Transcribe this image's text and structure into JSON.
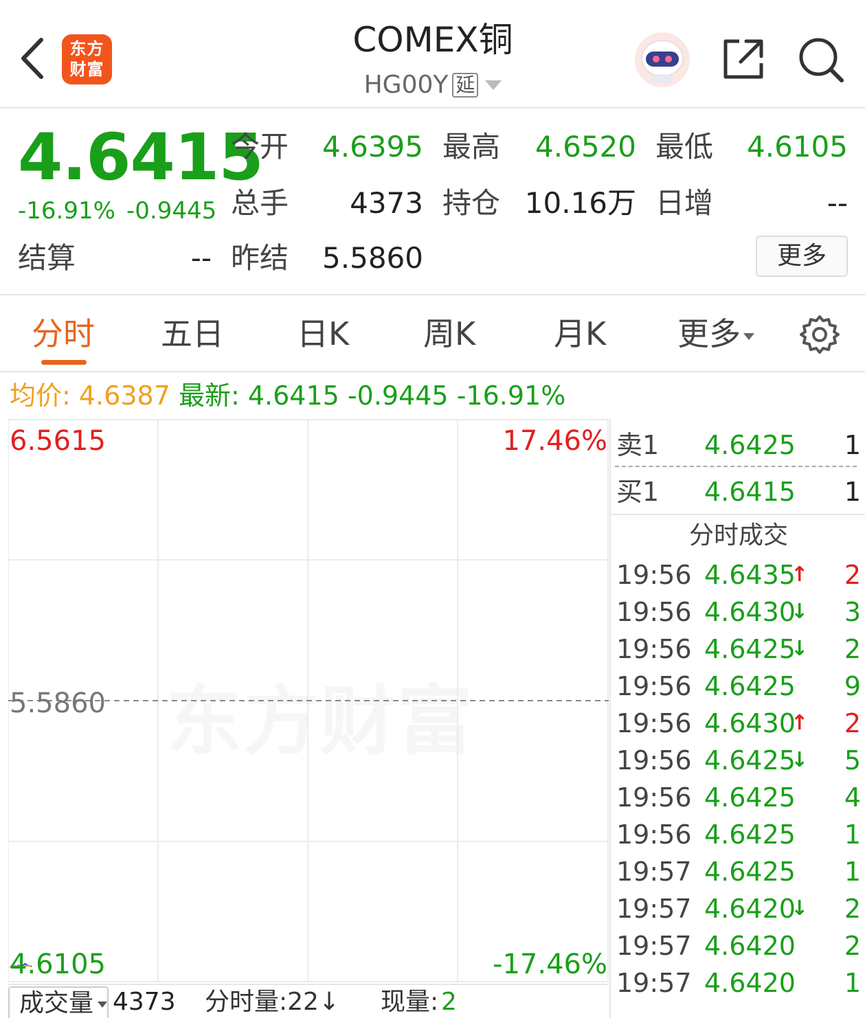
{
  "header": {
    "logo_text_line1": "东方",
    "logo_text_line2": "财富",
    "title": "COMEX铜",
    "code": "HG00Y",
    "delay_badge": "延"
  },
  "quote": {
    "price": "4.6415",
    "change_pct": "-16.91%",
    "change_amt": "-0.9445",
    "fields": {
      "open_label": "今开",
      "open_value": "4.6395",
      "high_label": "最高",
      "high_value": "4.6520",
      "low_label": "最低",
      "low_value": "4.6105",
      "volume_label": "总手",
      "volume_value": "4373",
      "oi_label": "持仓",
      "oi_value": "10.16万",
      "daily_inc_label": "日增",
      "daily_inc_value": "--",
      "settle_label": "结算",
      "settle_value": "--",
      "prev_settle_label": "昨结",
      "prev_settle_value": "5.5860"
    },
    "more_button": "更多"
  },
  "tabs": {
    "items": [
      "分时",
      "五日",
      "日K",
      "周K",
      "月K",
      "更多"
    ],
    "active_index": 0
  },
  "infoline": {
    "avg_label": "均价:",
    "avg_value": "4.6387",
    "latest_label": "最新:",
    "latest_value": "4.6415",
    "latest_chg": "-0.9445",
    "latest_pct": "-16.91%"
  },
  "chart": {
    "top_price": "6.5615",
    "mid_price": "5.5860",
    "bottom_price": "4.6105",
    "top_pct": "17.46%",
    "bottom_pct": "-17.46%",
    "watermark": "东方财富"
  },
  "chart_data": {
    "type": "line",
    "ylim": [
      4.6105,
      6.5615
    ],
    "reference": 5.586,
    "grid": true,
    "series": [
      {
        "values": [
          4.6395,
          4.642,
          4.638,
          4.644,
          4.641,
          4.646,
          4.643,
          4.65,
          4.647,
          4.652,
          4.648,
          4.644,
          4.645,
          4.6415
        ]
      }
    ]
  },
  "volume_bar": {
    "selector_label": "成交量",
    "total": "4373",
    "minute_vol": "分时量:22↓",
    "current_label": "现量:",
    "current_value": "2"
  },
  "orderbook": {
    "sell1_label": "卖1",
    "sell1_price": "4.6425",
    "sell1_qty": "1",
    "buy1_label": "买1",
    "buy1_price": "4.6415",
    "buy1_qty": "1"
  },
  "ticks": {
    "title": "分时成交",
    "rows": [
      {
        "time": "19:56",
        "price": "4.6435",
        "arrow": "↑",
        "vol": "2",
        "dir": "up"
      },
      {
        "time": "19:56",
        "price": "4.6430",
        "arrow": "↓",
        "vol": "3",
        "dir": "down"
      },
      {
        "time": "19:56",
        "price": "4.6425",
        "arrow": "↓",
        "vol": "2",
        "dir": "down"
      },
      {
        "time": "19:56",
        "price": "4.6425",
        "arrow": "",
        "vol": "9",
        "dir": "down"
      },
      {
        "time": "19:56",
        "price": "4.6430",
        "arrow": "↑",
        "vol": "2",
        "dir": "up"
      },
      {
        "time": "19:56",
        "price": "4.6425",
        "arrow": "↓",
        "vol": "5",
        "dir": "down"
      },
      {
        "time": "19:56",
        "price": "4.6425",
        "arrow": "",
        "vol": "4",
        "dir": "down"
      },
      {
        "time": "19:56",
        "price": "4.6425",
        "arrow": "",
        "vol": "1",
        "dir": "down"
      },
      {
        "time": "19:57",
        "price": "4.6425",
        "arrow": "",
        "vol": "1",
        "dir": "down"
      },
      {
        "time": "19:57",
        "price": "4.6420",
        "arrow": "↓",
        "vol": "2",
        "dir": "down"
      },
      {
        "time": "19:57",
        "price": "4.6420",
        "arrow": "",
        "vol": "2",
        "dir": "down"
      },
      {
        "time": "19:57",
        "price": "4.6420",
        "arrow": "",
        "vol": "1",
        "dir": "down"
      }
    ]
  },
  "colors": {
    "up": "#e02020",
    "down": "#1a9f1a",
    "accent": "#e8641b",
    "avg": "#f0a020"
  }
}
